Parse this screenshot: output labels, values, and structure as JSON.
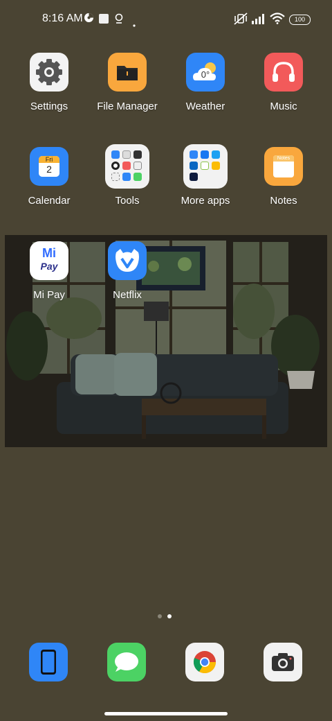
{
  "status_bar": {
    "time": "8:16 AM",
    "icons_left": [
      "data-saver-icon",
      "square-notification-icon",
      "location-pin-icon",
      "dot-icon"
    ],
    "icons_right": [
      "vibrate-off-icon",
      "signal-icon",
      "wifi-icon"
    ],
    "battery_level": "100"
  },
  "home_grid": [
    {
      "label": "Settings",
      "icon": "gear-icon",
      "bg": "#f3f3f3"
    },
    {
      "label": "File Manager",
      "icon": "folder-icon",
      "bg": "#f9a73d"
    },
    {
      "label": "Weather",
      "icon": "weather-cloud-icon",
      "bg": "#2f86f7",
      "temp": "0°"
    },
    {
      "label": "Music",
      "icon": "headphones-icon",
      "bg": "#f25a5a"
    },
    {
      "label": "Calendar",
      "icon": "calendar-icon",
      "bg": "#2f86f7",
      "day": "Fri",
      "date": "2"
    },
    {
      "label": "Tools",
      "icon": "folder-icon",
      "bg": "#f2f2f2"
    },
    {
      "label": "More apps",
      "icon": "folder-icon",
      "bg": "#f2f2f2"
    },
    {
      "label": "Notes",
      "icon": "notes-icon",
      "bg": "#f9a73d",
      "title": "Notes"
    }
  ],
  "widget_apps": [
    {
      "label": "Mi Pay",
      "icon": "mi-pay-icon",
      "bg": "#ffffff",
      "mi": "Mi",
      "pay": "Pay"
    },
    {
      "label": "Netflix",
      "icon": "netflix-icon",
      "bg": "#2f86f7"
    }
  ],
  "page_indicator": {
    "pages": 2,
    "current": 2
  },
  "dock": [
    {
      "name": "phone",
      "icon": "phone-icon",
      "bg": "#2f86f7"
    },
    {
      "name": "messages",
      "icon": "message-bubble-icon",
      "bg": "#4cd264"
    },
    {
      "name": "chrome",
      "icon": "chrome-icon",
      "bg": "#f2f2f2"
    },
    {
      "name": "camera",
      "icon": "camera-icon",
      "bg": "#f2f2f2"
    }
  ]
}
